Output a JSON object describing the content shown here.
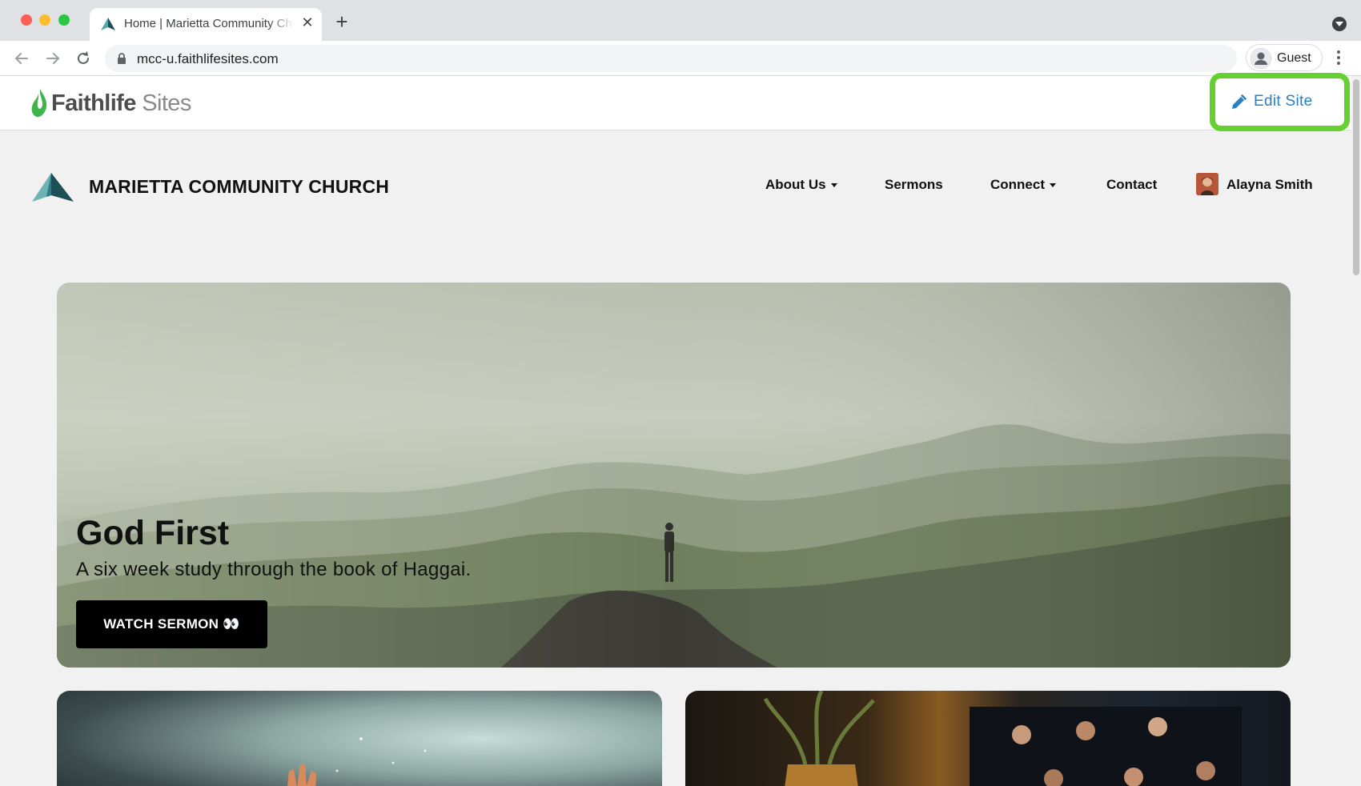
{
  "browser": {
    "tab_title": "Home | Marietta Community Church",
    "new_tab_symbol": "+",
    "close_symbol": "✕",
    "url": "mcc-u.faithlifesites.com",
    "profile_label": "Guest"
  },
  "faithlife": {
    "brand_bold": "Faithlife",
    "brand_light": "Sites",
    "edit_button_label": "Edit Site",
    "accent_color": "#2a7fc0",
    "highlight_color": "#65d131"
  },
  "site": {
    "church_name": "MARIETTA COMMUNITY CHURCH",
    "nav": {
      "about": "About Us",
      "sermons": "Sermons",
      "connect": "Connect",
      "contact": "Contact",
      "user_name": "Alayna Smith"
    },
    "hero": {
      "title": "God First",
      "subtitle": "A six week study through the book of Haggai.",
      "button_label": "WATCH SERMON 👀"
    }
  }
}
